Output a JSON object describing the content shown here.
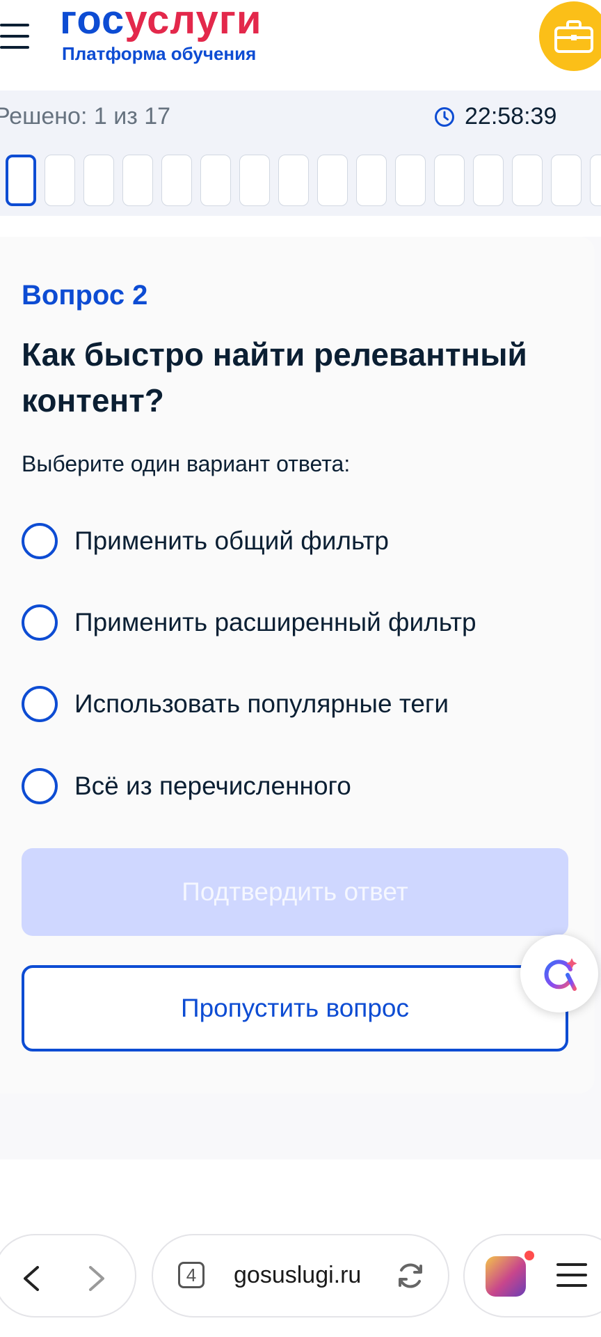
{
  "header": {
    "logo_part1": "гос",
    "logo_part2": "услуги",
    "subtitle": "Платформа обучения",
    "menu_icon": "burger-menu-icon",
    "briefcase_icon": "briefcase-icon",
    "brand_color": "#0d4cd3",
    "accent_color": "#e3284b"
  },
  "progress": {
    "solved_text": "Решено: 1 из 17",
    "timer": "22:58:39",
    "timer_icon": "clock-icon",
    "total_questions": 17,
    "current_index": 1
  },
  "question": {
    "number": "Вопрос 2",
    "title": "Как быстро найти релевантный контент?",
    "hint": "Выберите один вариант ответа:",
    "options": [
      {
        "label": "Применить общий фильтр"
      },
      {
        "label": "Применить расширенный фильтр"
      },
      {
        "label": "Использовать популярные теги"
      },
      {
        "label": "Всё из перечисленного"
      }
    ],
    "confirm_label": "Подтвердить ответ",
    "skip_label": "Пропустить вопрос"
  },
  "browser": {
    "url": "gosuslugi.ru",
    "tab_count": "4",
    "back_icon": "back-arrow-icon",
    "forward_icon": "forward-arrow-icon",
    "reload_icon": "reload-icon",
    "menu_icon": "hamburger-icon"
  }
}
